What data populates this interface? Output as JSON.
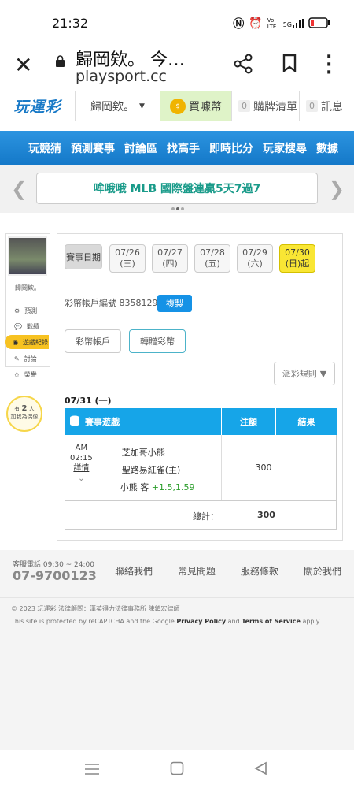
{
  "status_bar": {
    "time": "21:32",
    "icons": [
      "nfc-icon",
      "alarm-icon",
      "volte-icon",
      "5g-signal-icon",
      "battery-icon"
    ],
    "network": "5G",
    "volte": "Vo LTE"
  },
  "browser": {
    "page_title": "歸岡欸。 今…",
    "url": "playsport.cc"
  },
  "topnav": {
    "logo": "玩運彩",
    "username": "歸岡欸。",
    "coin_label": "買噱幣",
    "cart_count": "0",
    "cart_label": "購牌清單",
    "msg_count": "0",
    "msg_label": "訊息"
  },
  "menu": [
    "玩競猜",
    "預測賽事",
    "討論區",
    "找高手",
    "即時比分",
    "玩家搜尋",
    "數據"
  ],
  "banner": {
    "text": "哞哦哦 MLB 國際盤連贏5天7過7"
  },
  "sidebar": {
    "name": "歸岡欸。",
    "items": [
      {
        "label": "預測",
        "icon": "gear-icon"
      },
      {
        "label": "戰績",
        "icon": "chat-icon"
      },
      {
        "label": "遊戲紀錄",
        "icon": "circle-icon"
      },
      {
        "label": "討論",
        "icon": "pencil-icon"
      },
      {
        "label": "榮譽",
        "icon": "star-icon"
      }
    ],
    "bulb": {
      "prefix": "有",
      "count": "2",
      "suffix": "人",
      "line2": "加我為偶像"
    }
  },
  "dates": {
    "label": "賽事日期",
    "buttons": [
      {
        "date": "07/26",
        "day": "(三)"
      },
      {
        "date": "07/27",
        "day": "(四)"
      },
      {
        "date": "07/28",
        "day": "(五)"
      },
      {
        "date": "07/29",
        "day": "(六)"
      },
      {
        "date": "07/30",
        "day": "(日)起"
      }
    ]
  },
  "account": {
    "label": "彩幣帳戶編號",
    "number": "83581298",
    "copy_label": "複製"
  },
  "tabs": [
    "彩幣帳戶",
    "轉贈彩幣"
  ],
  "rule_button": "派彩規則",
  "table": {
    "date": "07/31 (一)",
    "headers": [
      "賽事遊戲",
      "注額",
      "結果"
    ],
    "row": {
      "ampm": "AM",
      "time": "02:15",
      "detail": "詳情",
      "away": "芝加哥小熊",
      "home": "聖路易紅雀(主)",
      "pick_team": "小熊 客",
      "pick_line": "+1.5",
      "pick_odds": "1.59",
      "stake": "300",
      "result": ""
    },
    "total_label": "總計：",
    "total_value": "300"
  },
  "footer": {
    "hotline_label": "客服電話 09:30 ~ 24:00",
    "phone": "07-9700123",
    "links": [
      "聯絡我們",
      "常見問題",
      "服務條款",
      "關於我們"
    ],
    "copyright": "© 2023 玩運彩 法律顧問：漢英得力法律事務所 陳鎮宏律師",
    "recaptcha_pre": "This site is protected by reCAPTCHA and the Google ",
    "privacy": "Privacy Policy",
    "and": " and ",
    "terms": "Terms of Service",
    "apply": " apply."
  }
}
